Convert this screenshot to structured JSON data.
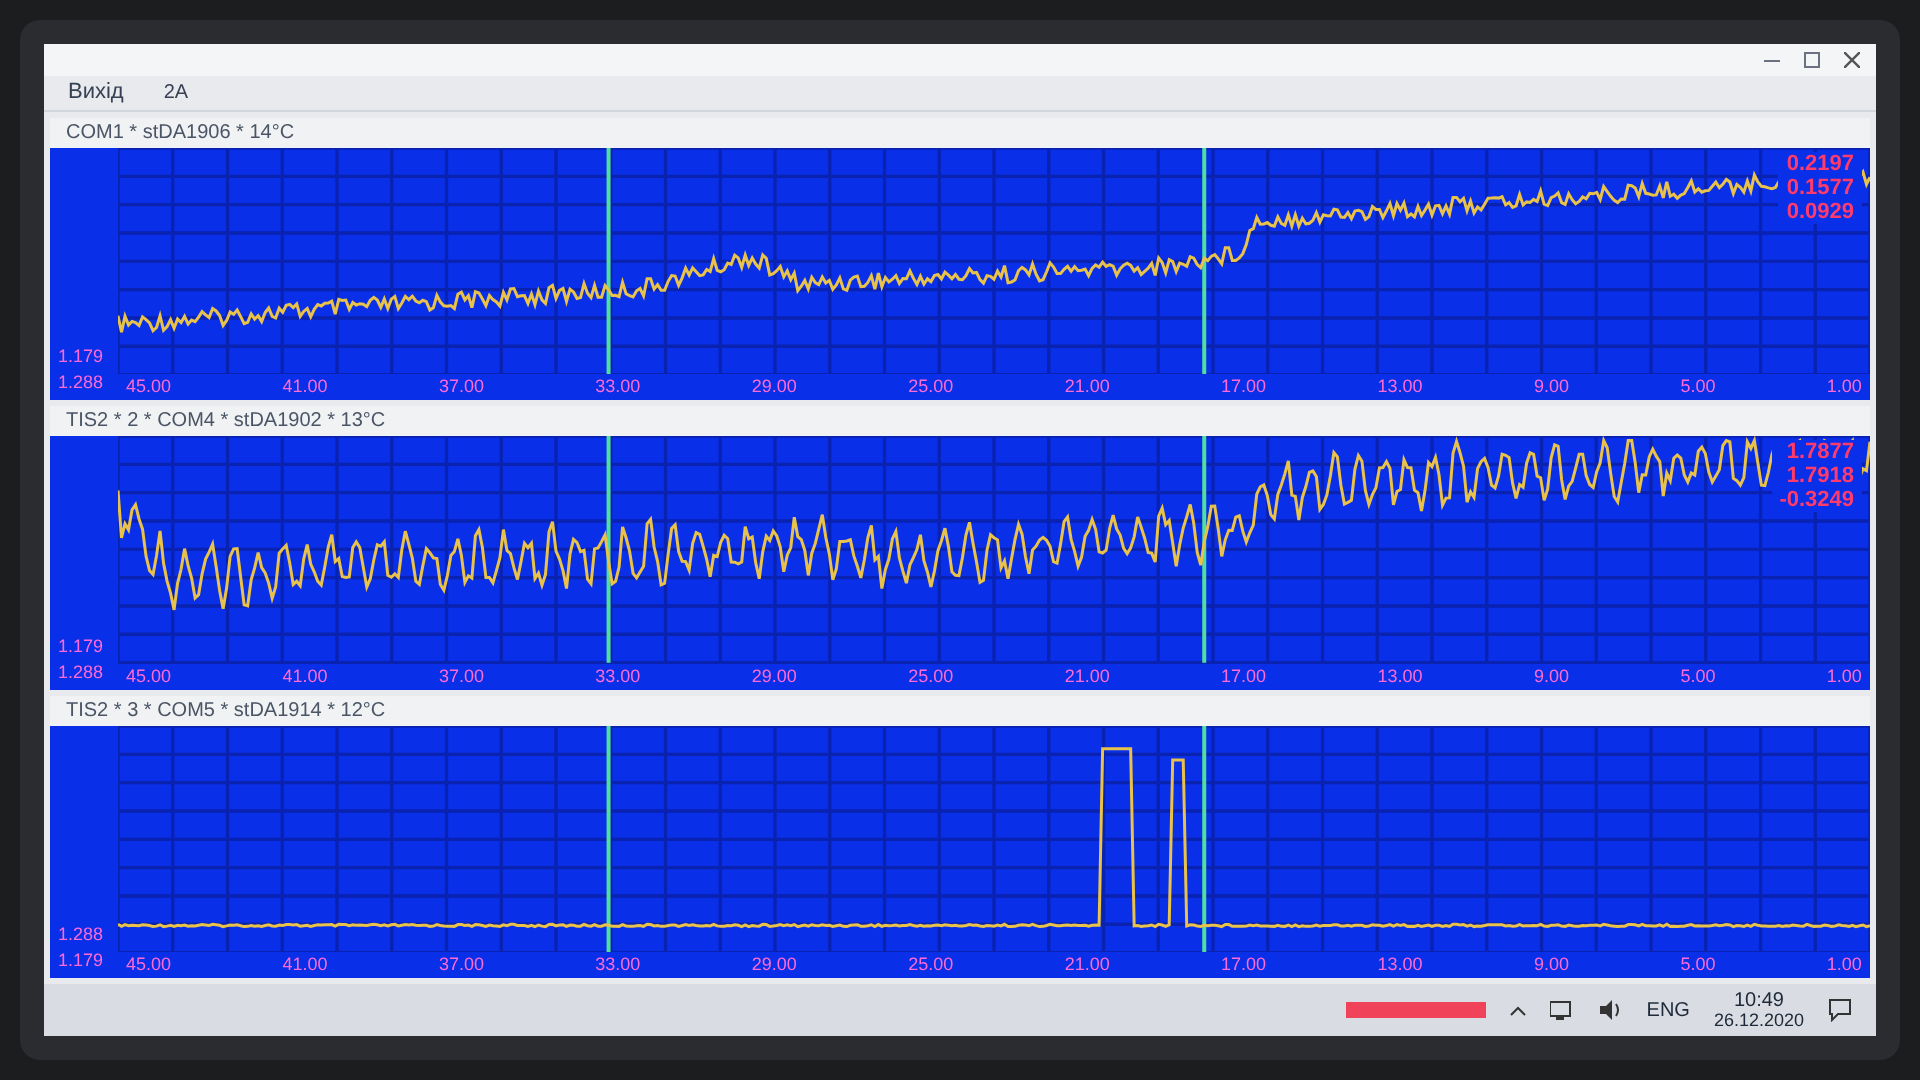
{
  "menu": {
    "items": [
      "Вихід"
    ]
  },
  "toolbar": {
    "items": [
      "2A"
    ]
  },
  "panels": [
    {
      "title": "COM1 * stDA1906 * 14°C",
      "kind": "drift",
      "readings": [
        "0.2197",
        "0.1577",
        "0.0929"
      ],
      "y_labels": [
        "1.179",
        "1.288"
      ],
      "x_labels": [
        "45.00",
        "41.00",
        "37.00",
        "33.00",
        "29.00",
        "25.00",
        "21.00",
        "17.00",
        "13.00",
        "9.00",
        "5.00",
        "1.00"
      ]
    },
    {
      "title": "TIS2 * 2 * COM4 * stDA1902 * 13°C",
      "kind": "oscillating",
      "readings": [
        "1.7877",
        "1.7918",
        "-0.3249"
      ],
      "y_labels": [
        "1.179",
        "1.288"
      ],
      "x_labels": [
        "45.00",
        "41.00",
        "37.00",
        "33.00",
        "29.00",
        "25.00",
        "21.00",
        "17.00",
        "13.00",
        "9.00",
        "5.00",
        "1.00"
      ]
    },
    {
      "title": "TIS2 * 3 * COM5 * stDA1914 * 12°C",
      "kind": "spike",
      "y_labels": [
        "1.288",
        "1.179"
      ],
      "x_labels": [
        "45.00",
        "41.00",
        "37.00",
        "33.00",
        "29.00",
        "25.00",
        "21.00",
        "17.00",
        "13.00",
        "9.00",
        "5.00",
        "1.00"
      ]
    }
  ],
  "taskbar": {
    "language": "ENG",
    "time": "10:49",
    "date": "26.12.2020"
  }
}
